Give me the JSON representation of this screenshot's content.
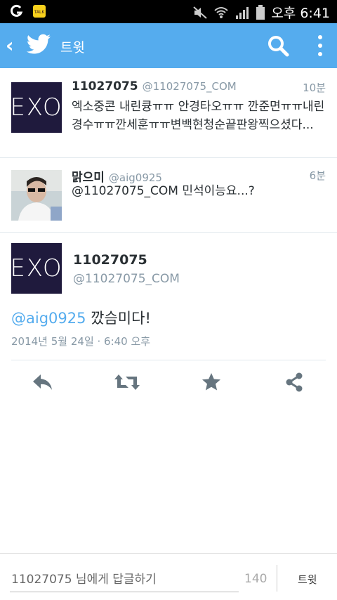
{
  "statusbar": {
    "time": "오후 6:41",
    "notif_icons": [
      "g-icon",
      "kakao-talk-icon"
    ],
    "status_icons": [
      "mute-icon",
      "wifi-icon",
      "signal-icon",
      "battery-icon"
    ]
  },
  "actionbar": {
    "title": "트윗",
    "accent": "#55acee"
  },
  "tweets": [
    {
      "name": "11027075",
      "handle": "@11027075_COM",
      "time": "10분",
      "text": "엑소중콘 내린큥ㅠㅠ 안경타오ㅠㅠ 깐준면ㅠㅠ내린경수ㅠㅠ깐세훈ㅠㅠ변백현청순끝판왕찍으셨다...",
      "avatar": "EXO"
    },
    {
      "name": "맑으미",
      "handle": "@aig0925",
      "time": "6분",
      "text": "@11027075_COM 민석이능요...?"
    }
  ],
  "detail": {
    "avatar": "EXO",
    "name": "11027075",
    "handle": "@11027075_COM",
    "mention": "@aig0925",
    "text": " 깠슴미다!",
    "date": "2014년 5월 24일 · 6:40 오후"
  },
  "actions": [
    "reply-icon",
    "retweet-icon",
    "favorite-icon",
    "share-icon"
  ],
  "reply": {
    "placeholder": "11027075 님에게 답글하기",
    "count": "140",
    "send": "트윗"
  }
}
